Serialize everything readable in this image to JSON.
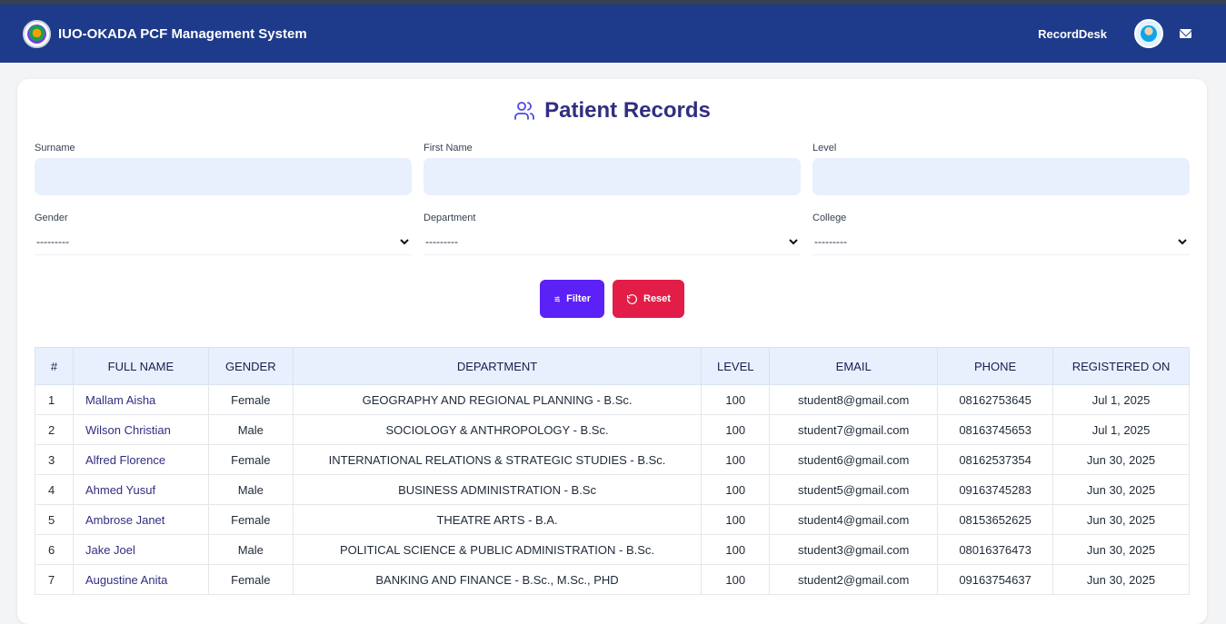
{
  "app": {
    "title": "IUO-OKADA PCF Management System",
    "nav_link": "RecordDesk"
  },
  "page": {
    "title": "Patient Records"
  },
  "filters": {
    "surname_label": "Surname",
    "first_name_label": "First Name",
    "level_label": "Level",
    "gender_label": "Gender",
    "gender_value": "---------",
    "department_label": "Department",
    "department_value": "---------",
    "college_label": "College",
    "college_value": "---------",
    "filter_button": "Filter",
    "reset_button": "Reset"
  },
  "table": {
    "headers": [
      "#",
      "FULL NAME",
      "GENDER",
      "DEPARTMENT",
      "LEVEL",
      "EMAIL",
      "PHONE",
      "REGISTERED ON"
    ],
    "rows": [
      [
        "1",
        "Mallam Aisha",
        "Female",
        "GEOGRAPHY AND REGIONAL PLANNING - B.Sc.",
        "100",
        "student8@gmail.com",
        "08162753645",
        "Jul 1, 2025"
      ],
      [
        "2",
        "Wilson Christian",
        "Male",
        "SOCIOLOGY & ANTHROPOLOGY - B.Sc.",
        "100",
        "student7@gmail.com",
        "08163745653",
        "Jul 1, 2025"
      ],
      [
        "3",
        "Alfred Florence",
        "Female",
        "INTERNATIONAL RELATIONS & STRATEGIC STUDIES - B.Sc.",
        "100",
        "student6@gmail.com",
        "08162537354",
        "Jun 30, 2025"
      ],
      [
        "4",
        "Ahmed Yusuf",
        "Male",
        "BUSINESS ADMINISTRATION - B.Sc",
        "100",
        "student5@gmail.com",
        "09163745283",
        "Jun 30, 2025"
      ],
      [
        "5",
        "Ambrose Janet",
        "Female",
        "THEATRE ARTS - B.A.",
        "100",
        "student4@gmail.com",
        "08153652625",
        "Jun 30, 2025"
      ],
      [
        "6",
        "Jake Joel",
        "Male",
        "POLITICAL SCIENCE & PUBLIC ADMINISTRATION - B.Sc.",
        "100",
        "student3@gmail.com",
        "08016376473",
        "Jun 30, 2025"
      ],
      [
        "7",
        "Augustine Anita",
        "Female",
        "BANKING AND FINANCE - B.Sc., M.Sc., PHD",
        "100",
        "student2@gmail.com",
        "09163754637",
        "Jun 30, 2025"
      ]
    ]
  },
  "colors": {
    "navbar": "#1e3a8a",
    "primary": "#5b21f6",
    "danger": "#e11d48",
    "heading": "#312e81"
  },
  "icons": {
    "logo": "university-logo",
    "avatar": "user-avatar",
    "mail": "mail-icon",
    "heading": "users-icon",
    "filter": "sliders-icon",
    "reset": "rotate-ccw-icon"
  }
}
